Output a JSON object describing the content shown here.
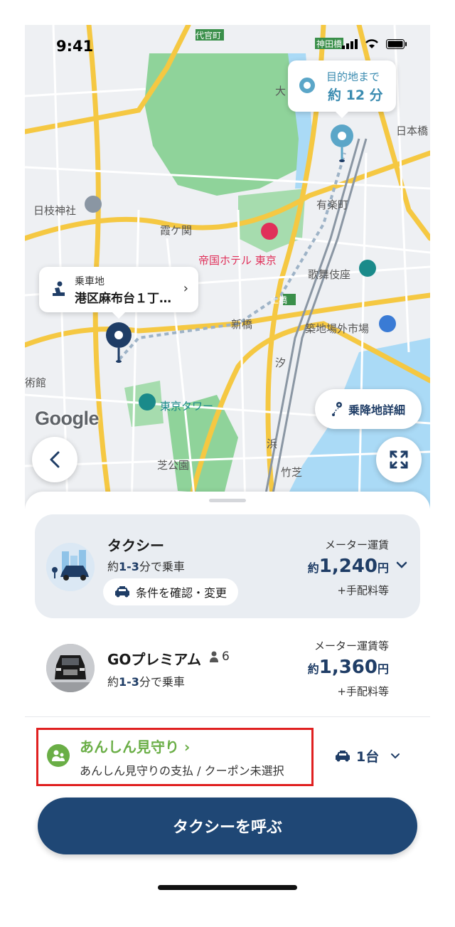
{
  "status_bar": {
    "time": "9:41"
  },
  "map": {
    "destination_callout": {
      "label": "目的地まで",
      "duration": "約 12 分"
    },
    "pickup_callout": {
      "label": "乗車地",
      "address": "港区麻布台１丁…"
    },
    "labels": {
      "hibiya": "日枝神社",
      "kasumigaseki": "霞ケ関",
      "imperial_hotel": "帝国ホテル 東京",
      "kabukiza": "歌舞伎座",
      "tsukiji": "築地場外市場",
      "shinbashi": "新橋",
      "tokyo_tower": "東京タワー",
      "shiba_park": "芝公園",
      "yurakucho": "有楽町",
      "nihonbashi": "日本橋",
      "daikanyama": "代官町",
      "kanda": "神田橋",
      "hamamatsucho": "浜",
      "dobashi": "土橋",
      "museum": "術館",
      "takeshiba": "竹芝",
      "otemachi": "大",
      "shiodome": "汐"
    },
    "google_logo": "Google",
    "pickup_detail_button": "乗降地詳細"
  },
  "options": {
    "taxi": {
      "name": "タクシー",
      "eta_pre": "約",
      "eta_range": "1-3",
      "eta_post": "分で乗車",
      "condition_button": "条件を確認・変更",
      "fare_label": "メーター運賃",
      "fare_prefix": "約",
      "fare_value": "1,240",
      "fare_unit": "円",
      "fare_sub": "+手配料等"
    },
    "premium": {
      "name": "GOプレミアム",
      "capacity": "6",
      "eta_pre": "約",
      "eta_range": "1-3",
      "eta_post": "分で乗車",
      "fare_label": "メーター運賃等",
      "fare_prefix": "約",
      "fare_value": "1,360",
      "fare_unit": "円",
      "fare_sub": "+手配料等"
    }
  },
  "watch": {
    "title": "あんしん見守り",
    "subtitle": "あんしん見守りの支払 / クーポン未選択"
  },
  "vehicle_count": "1台",
  "call_button": "タクシーを呼ぶ",
  "colors": {
    "brand_navy": "#1f4775",
    "fare_navy": "#1f3d66",
    "watch_green": "#6aae46",
    "highlight_red": "#e02020",
    "destination_blue": "#5ba6c8"
  }
}
